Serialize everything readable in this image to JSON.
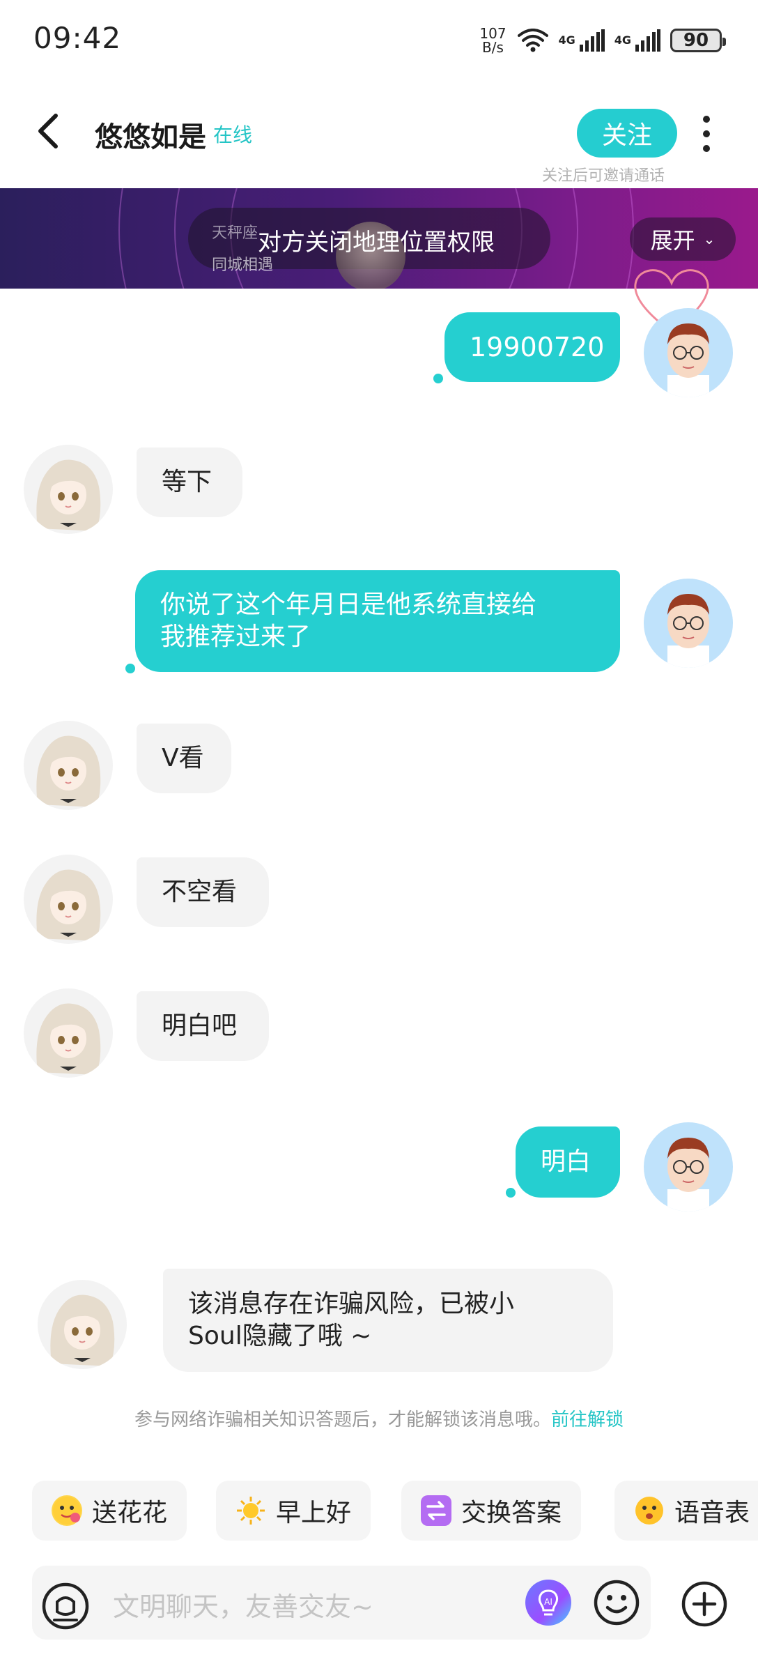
{
  "status_bar": {
    "time": "09:42",
    "net_speed_value": "107",
    "net_speed_unit": "B/s",
    "sim1": "4G",
    "sim2": "4G",
    "battery": "90"
  },
  "header": {
    "name": "悠悠如是",
    "online_status": "在线",
    "follow_label": "关注",
    "follow_hint": "关注后可邀请通话"
  },
  "banner": {
    "zodiac": "天秤座",
    "city_match": "同城相遇",
    "location_text": "对方关闭地理位置权限",
    "expand_label": "展开"
  },
  "messages": [
    {
      "from": "me",
      "text": "19900720"
    },
    {
      "from": "her",
      "text": "等下"
    },
    {
      "from": "me",
      "text_line1": "你说了这个年月日是他系统直接给",
      "text_line2": "我推荐过来了"
    },
    {
      "from": "her",
      "text": "V看"
    },
    {
      "from": "her",
      "text": "不空看"
    },
    {
      "from": "her",
      "text": "明白吧"
    },
    {
      "from": "me",
      "text": "明白"
    },
    {
      "from": "her",
      "text_line1": "该消息存在诈骗风险，已被小",
      "text_line2": "Soul隐藏了哦 ~"
    }
  ],
  "notice": {
    "text": "参与网络诈骗相关知识答题后，才能解锁该消息哦。",
    "link": "前往解锁"
  },
  "quick_replies": [
    {
      "label": "送花花",
      "icon": "flower-emoji-icon"
    },
    {
      "label": "早上好",
      "icon": "sun-icon"
    },
    {
      "label": "交换答案",
      "icon": "swap-icon"
    },
    {
      "label": "语音表",
      "icon": "voice-emoji-icon"
    }
  ],
  "input": {
    "placeholder": "文明聊天，友善交友~"
  },
  "colors": {
    "accent": "#25cfd0",
    "bubble_other": "#f3f3f3",
    "banner_start": "#2b1f5c",
    "banner_end": "#9a1a8c"
  }
}
